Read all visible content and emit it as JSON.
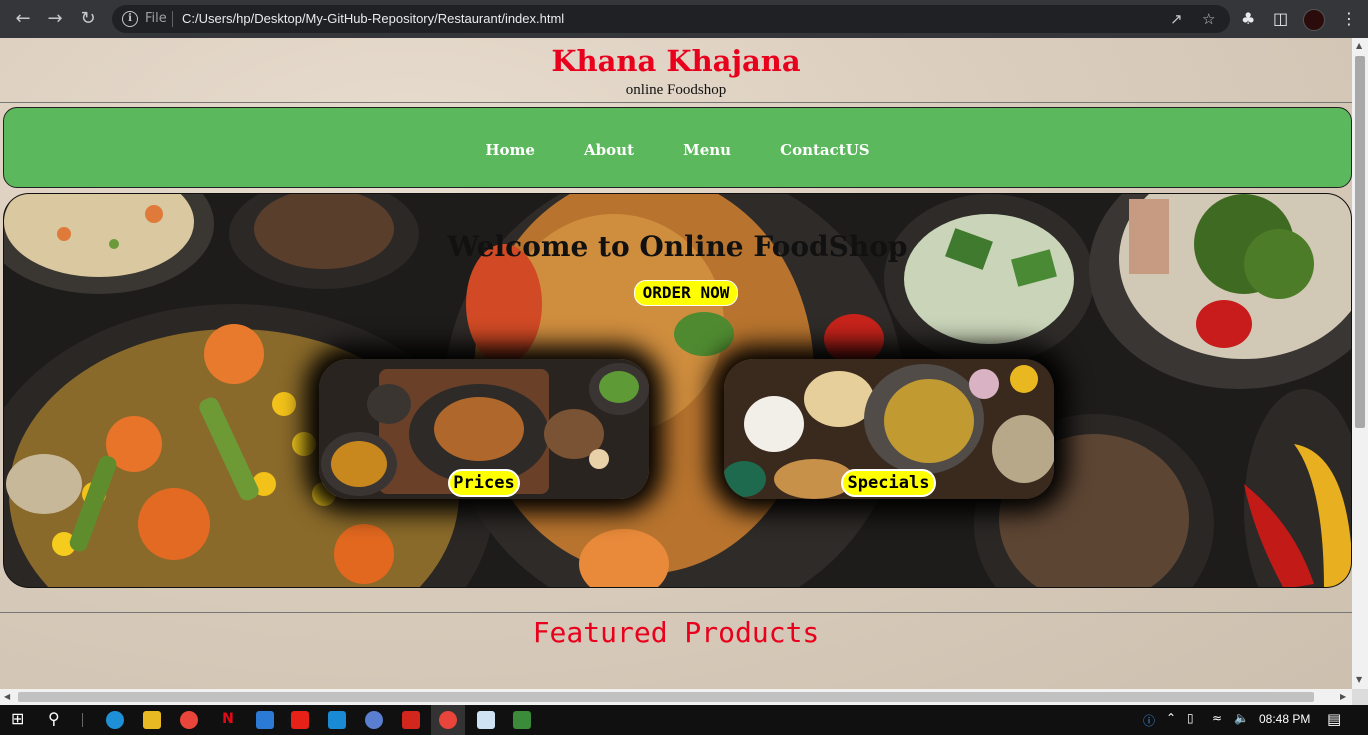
{
  "browser": {
    "file_label": "File",
    "url": "C:/Users/hp/Desktop/My-GitHub-Repository/Restaurant/index.html"
  },
  "site": {
    "title": "Khana Khajana",
    "subtitle": "online Foodshop"
  },
  "nav": {
    "items": [
      {
        "label": "Home"
      },
      {
        "label": "About"
      },
      {
        "label": "Menu"
      },
      {
        "label": "ContactUS"
      }
    ]
  },
  "hero": {
    "heading": "Welcome to Online FoodShop",
    "order_button": "ORDER NOW",
    "cards": [
      {
        "label": "Prices"
      },
      {
        "label": "Specials"
      }
    ]
  },
  "featured": {
    "heading": "Featured Products"
  },
  "taskbar": {
    "time": "08:48 PM"
  },
  "colors": {
    "brand_red": "#e8001c",
    "nav_green": "#5cb85c",
    "button_yellow": "#ffff00"
  }
}
